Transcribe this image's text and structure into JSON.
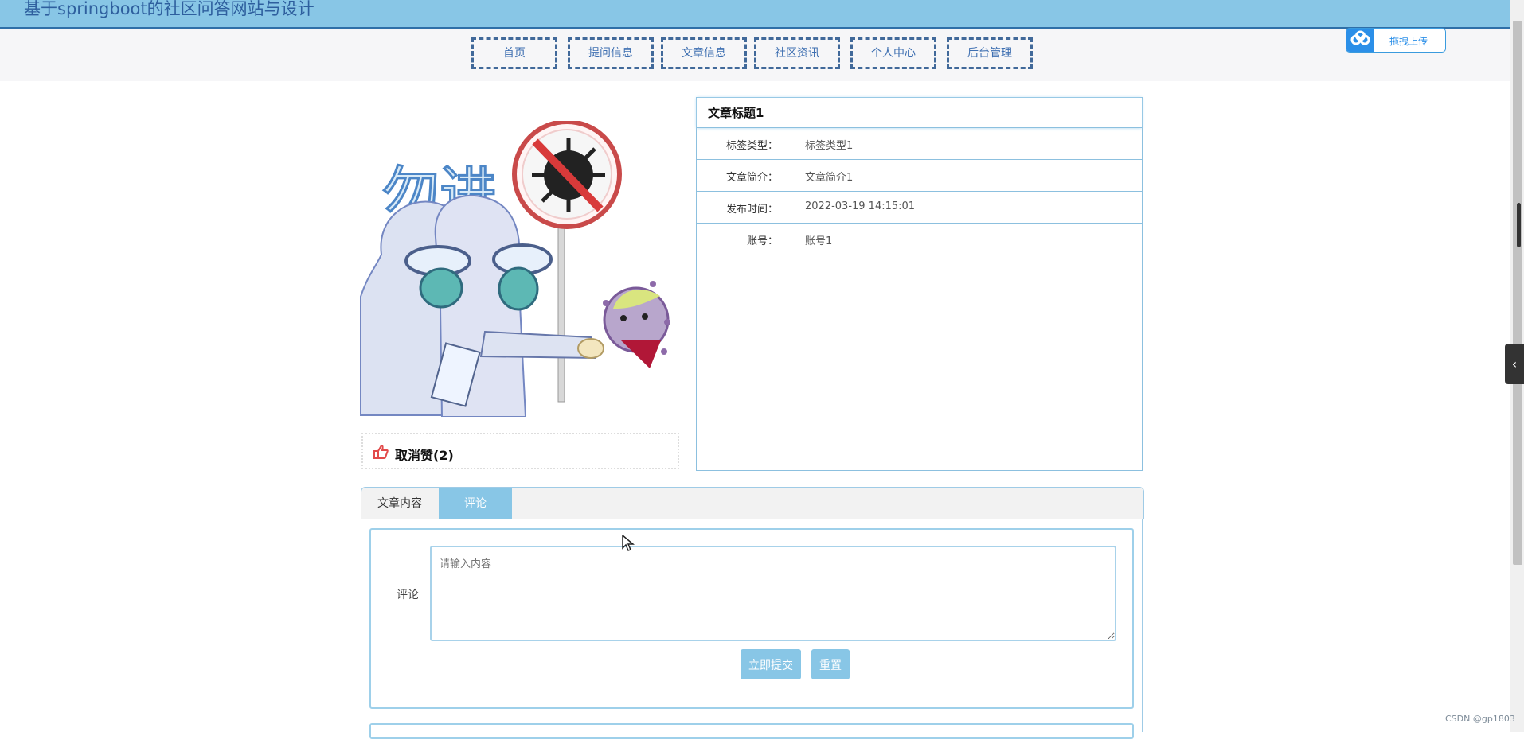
{
  "header": {
    "site_title": "基于springboot的社区问答网站与设计",
    "upload_label": "拖拽上传"
  },
  "nav": {
    "items": [
      "首页",
      "提问信息",
      "文章信息",
      "社区资讯",
      "个人中心",
      "后台管理"
    ]
  },
  "image": {
    "caption_text": "勿进",
    "description": "protective-suit staff with no-virus sign"
  },
  "like": {
    "label": "取消赞(2)"
  },
  "detail": {
    "title": "文章标题1",
    "rows": [
      {
        "label": "标签类型：",
        "value": "标签类型1"
      },
      {
        "label": "文章简介：",
        "value": "文章简介1"
      },
      {
        "label": "发布时间：",
        "value": "2022-03-19 14:15:01"
      },
      {
        "label": "账号：",
        "value": "账号1"
      }
    ]
  },
  "tabs": {
    "content_label": "文章内容",
    "comment_label": "评论",
    "active": "评论"
  },
  "comment_form": {
    "label": "评论",
    "placeholder": "请输入内容",
    "submit_label": "立即提交",
    "reset_label": "重置"
  },
  "watermark": "CSDN @gp1803",
  "colors": {
    "topbar": "#88c6e6",
    "nav_border": "#41699a",
    "accent": "#88c6e6",
    "border": "#8cc0df",
    "like_icon": "#e24a4a"
  }
}
